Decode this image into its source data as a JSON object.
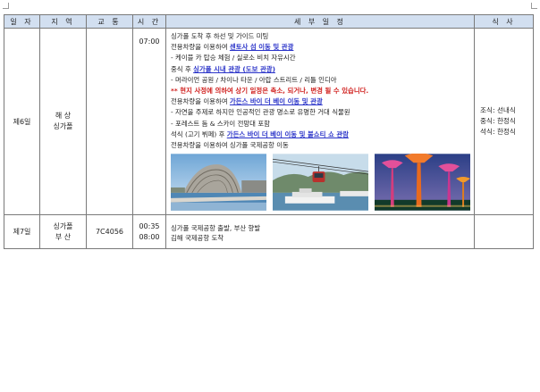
{
  "headers": {
    "day": "일 자",
    "region": "지 역",
    "transport": "교 통",
    "time": "시 간",
    "details": "세 부 일 정",
    "meals": "식 사"
  },
  "day6": {
    "day": "제6일",
    "region_line1": "해 상",
    "region_line2": "싱가폴",
    "transport": "",
    "time": "07:00",
    "lines": [
      {
        "parts": [
          {
            "text": "싱가폴 도착 후 하선 및 가이드 미팅",
            "style": ""
          }
        ]
      },
      {
        "parts": [
          {
            "text": "전용차량을 이용하여 ",
            "style": ""
          },
          {
            "text": "센토사 섬 이동 및 관광",
            "style": "blue"
          }
        ]
      },
      {
        "parts": [
          {
            "text": "- 케이블 카 탑승 체험 / 실로소 비치 자유시간",
            "style": ""
          }
        ]
      },
      {
        "parts": [
          {
            "text": "중식 후 ",
            "style": ""
          },
          {
            "text": "싱가폴 시내 관광 (도보 관광)",
            "style": "blue"
          }
        ]
      },
      {
        "parts": [
          {
            "text": "- 머라이언 공원 / 차이나 타운 / 아랍 스트리트 / 리틀 인디아",
            "style": ""
          }
        ]
      },
      {
        "parts": [
          {
            "text": "** 현지 사정에 의하여 상기 일정은 축소, 되거나, 변경 될 수 있습니다.",
            "style": "red"
          }
        ]
      },
      {
        "parts": [
          {
            "text": "전용차량을 이용하여 ",
            "style": ""
          },
          {
            "text": "가든스 바이 더 베이 이동 및 관광",
            "style": "blue"
          }
        ]
      },
      {
        "parts": [
          {
            "text": "- 자연을 주제로 하지만 인공적인 관광 명소로 유명한 거대 식물원",
            "style": ""
          }
        ]
      },
      {
        "parts": [
          {
            "text": "- 포레스트 돔 & 스카이 전망대 포함",
            "style": ""
          }
        ]
      },
      {
        "parts": [
          {
            "text": "석식 (고기 뷔페) 후 ",
            "style": ""
          },
          {
            "text": "가든스 바이 더 베이 이동 및 불쇼티 쇼 관람",
            "style": "blue"
          }
        ]
      },
      {
        "parts": [
          {
            "text": "전용차량을 이용하여 싱가폴 국제공항 이동",
            "style": ""
          }
        ]
      }
    ],
    "meals": [
      "조식: 선내식",
      "중식: 한정식",
      "석식: 한정식"
    ]
  },
  "day7": {
    "day": "제7일",
    "region_line1": "싱가폴",
    "region_line2": "부 산",
    "transport": "7C4056",
    "time1": "00:35",
    "time2": "08:00",
    "lines": [
      "싱가폴 국제공항 출발, 부산 향발",
      "김해 국제공항 도착"
    ],
    "meals": ""
  },
  "colors": {
    "header_bg": "#d2dff0",
    "border": "#7a7a7a",
    "highlight_blue": "#2b34c9",
    "warning_red": "#d0201e"
  },
  "photos": [
    "esplanade-photo",
    "cable-car-photo",
    "supertree-grove-photo"
  ]
}
